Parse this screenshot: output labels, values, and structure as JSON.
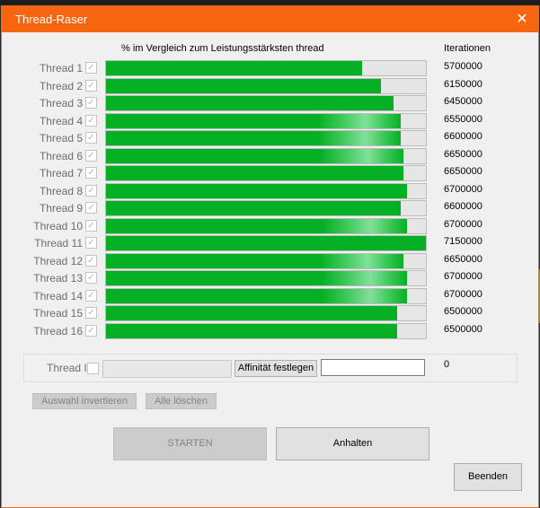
{
  "window": {
    "title": "Thread-Raser",
    "close_glyph": "✕"
  },
  "header": {
    "progress_label": "% im Vergleich zum Leistungsstärksten thread",
    "iterations_label": "Iterationen"
  },
  "threads": [
    {
      "label": "Thread 1",
      "checked": true,
      "iterations": "5700000",
      "fill_percent": 80
    },
    {
      "label": "Thread 2",
      "checked": true,
      "iterations": "6150000",
      "fill_percent": 86
    },
    {
      "label": "Thread 3",
      "checked": true,
      "iterations": "6450000",
      "fill_percent": 90
    },
    {
      "label": "Thread 4",
      "checked": true,
      "iterations": "6550000",
      "fill_percent": 92
    },
    {
      "label": "Thread 5",
      "checked": true,
      "iterations": "6600000",
      "fill_percent": 92
    },
    {
      "label": "Thread 6",
      "checked": true,
      "iterations": "6650000",
      "fill_percent": 93
    },
    {
      "label": "Thread 7",
      "checked": true,
      "iterations": "6650000",
      "fill_percent": 93
    },
    {
      "label": "Thread 8",
      "checked": true,
      "iterations": "6700000",
      "fill_percent": 94
    },
    {
      "label": "Thread 9",
      "checked": true,
      "iterations": "6600000",
      "fill_percent": 92
    },
    {
      "label": "Thread 10",
      "checked": true,
      "iterations": "6700000",
      "fill_percent": 94
    },
    {
      "label": "Thread 11",
      "checked": true,
      "iterations": "7150000",
      "fill_percent": 100
    },
    {
      "label": "Thread 12",
      "checked": true,
      "iterations": "6650000",
      "fill_percent": 93
    },
    {
      "label": "Thread 13",
      "checked": true,
      "iterations": "6700000",
      "fill_percent": 94
    },
    {
      "label": "Thread 14",
      "checked": true,
      "iterations": "6700000",
      "fill_percent": 94
    },
    {
      "label": "Thread 15",
      "checked": true,
      "iterations": "6500000",
      "fill_percent": 91
    },
    {
      "label": "Thread 16",
      "checked": true,
      "iterations": "6500000",
      "fill_percent": 91
    }
  ],
  "thread_i": {
    "label": "Thread I",
    "affinity_button": "Affinität festlegen",
    "affinity_value": "",
    "value": "0"
  },
  "buttons": {
    "invert_selection": "Auswahl invertieren",
    "clear_all": "Alle löschen",
    "start": "STARTEN",
    "stop": "Anhalten",
    "exit": "Beenden"
  },
  "colors": {
    "accent": "#f8650f",
    "progress": "#06b025"
  },
  "icons": {
    "checkbox_checked": "checkmark-icon",
    "close": "close-icon"
  }
}
